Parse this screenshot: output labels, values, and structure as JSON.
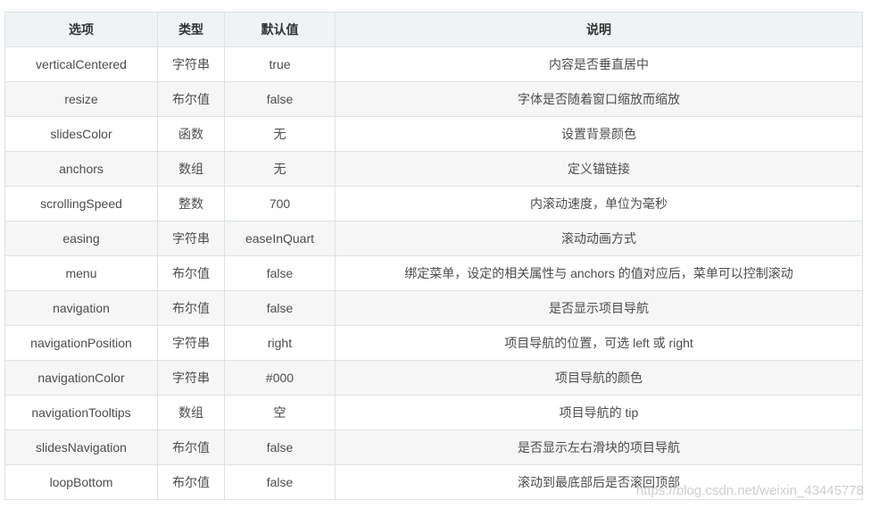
{
  "colors": {
    "header_bg": "#eff3f5",
    "stripe_bg": "#f6f6f6",
    "border": "#dde2e5",
    "text": "#4d4d4d",
    "header_text": "#333333"
  },
  "table": {
    "headers": {
      "option": "选项",
      "type": "类型",
      "default": "默认值",
      "description": "说明"
    },
    "rows": [
      {
        "option": "verticalCentered",
        "type": "字符串",
        "default": "true",
        "description": "内容是否垂直居中"
      },
      {
        "option": "resize",
        "type": "布尔值",
        "default": "false",
        "description": "字体是否随着窗口缩放而缩放"
      },
      {
        "option": "slidesColor",
        "type": "函数",
        "default": "无",
        "description": "设置背景颜色"
      },
      {
        "option": "anchors",
        "type": "数组",
        "default": "无",
        "description": "定义锚链接"
      },
      {
        "option": "scrollingSpeed",
        "type": "整数",
        "default": "700",
        "description": "内滚动速度，单位为毫秒"
      },
      {
        "option": "easing",
        "type": "字符串",
        "default": "easeInQuart",
        "description": "滚动动画方式"
      },
      {
        "option": "menu",
        "type": "布尔值",
        "default": "false",
        "description": "绑定菜单，设定的相关属性与 anchors 的值对应后，菜单可以控制滚动"
      },
      {
        "option": "navigation",
        "type": "布尔值",
        "default": "false",
        "description": "是否显示项目导航"
      },
      {
        "option": "navigationPosition",
        "type": "字符串",
        "default": "right",
        "description": "项目导航的位置，可选 left 或 right"
      },
      {
        "option": "navigationColor",
        "type": "字符串",
        "default": "#000",
        "description": "项目导航的颜色"
      },
      {
        "option": "navigationTooltips",
        "type": "数组",
        "default": "空",
        "description": "项目导航的 tip"
      },
      {
        "option": "slidesNavigation",
        "type": "布尔值",
        "default": "false",
        "description": "是否显示左右滑块的项目导航"
      },
      {
        "option": "loopBottom",
        "type": "布尔值",
        "default": "false",
        "description": "滚动到最底部后是否滚回顶部"
      }
    ]
  },
  "watermark": "https://blog.csdn.net/weixin_43445778"
}
